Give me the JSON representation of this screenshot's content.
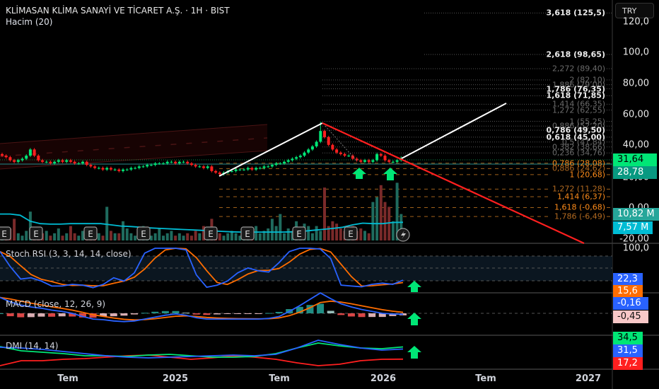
{
  "header": {
    "title": "KLİMASAN KLİMA SANAYİ VE TİCARET A.Ş. · 1H · BIST",
    "volume_indicator": "Hacim (20)"
  },
  "currency_button": "TRY",
  "price_axis": [
    "120,0",
    "100,0",
    "80,00",
    "60,00",
    "40,00",
    "20,00",
    "0,00",
    "-20,00"
  ],
  "price_badges": {
    "last": "31,64",
    "prev": "28,78",
    "volume": "10,82 M",
    "volume_ma": "7,57 M"
  },
  "fib_levels": [
    {
      "label": "3,618 (125,5)",
      "price": 125.5,
      "style": "bright"
    },
    {
      "label": "2,618 (98,65)",
      "price": 98.65,
      "style": "bright"
    },
    {
      "label": "2,272 (89,40)",
      "price": 89.4,
      "style": "dim"
    },
    {
      "label": "2 (82,10)",
      "price": 82.1,
      "style": "dim"
    },
    {
      "label": "1,886 (79,00)",
      "price": 79.0,
      "style": "dim"
    },
    {
      "label": "1,786 (76,35)",
      "price": 76.35,
      "style": "bright"
    },
    {
      "label": "1,618 (71,85)",
      "price": 71.85,
      "style": "bright"
    },
    {
      "label": "1,414 (66,35)",
      "price": 66.35,
      "style": "dim"
    },
    {
      "label": "1,272 (62,55)",
      "price": 62.55,
      "style": "dim"
    },
    {
      "label": "1 (55,25)",
      "price": 55.25,
      "style": "dim"
    },
    {
      "label": "0,886 (52,20)",
      "price": 52.2,
      "style": "dim"
    },
    {
      "label": "0,786 (49,50)",
      "price": 49.5,
      "style": "bright"
    },
    {
      "label": "0,618 (45,00)",
      "price": 45.0,
      "style": "bright"
    },
    {
      "label": "0,5 (41,84)",
      "price": 41.84,
      "style": "dim"
    },
    {
      "label": "0,382 (38,66)",
      "price": 38.66,
      "style": "dim"
    },
    {
      "label": "0,236 (34,76)",
      "price": 34.76,
      "style": "dim"
    },
    {
      "label": "0,786 (28,08)",
      "price": 28.08,
      "style": "orange"
    },
    {
      "label": "0,886 (24,62)",
      "price": 24.62,
      "style": "orange-dim"
    },
    {
      "label": "1 (20,68)",
      "price": 20.68,
      "style": "orange"
    },
    {
      "label": "1,272 (11,28)",
      "price": 11.28,
      "style": "orange-dim"
    },
    {
      "label": "1,414 (6,37)",
      "price": 6.37,
      "style": "orange"
    },
    {
      "label": "1,618 (-0,68)",
      "price": -0.68,
      "style": "orange"
    },
    {
      "label": "1,786 (-6,49)",
      "price": -6.49,
      "style": "orange-dim"
    }
  ],
  "indicators": {
    "stoch": {
      "label": "Stoch RSI (3, 3, 14, 14, close)",
      "axis_top": "100,0",
      "k_value": "22,3",
      "d_value": "15,6"
    },
    "macd": {
      "label": "MACD (close, 12, 26, 9)",
      "macd_value": "-0,16",
      "signal_value": "-0,45"
    },
    "dmi": {
      "label": "DMI (14, 14)",
      "plus_value": "34,5",
      "adx_value": "31,5",
      "minus_value": "17,2"
    }
  },
  "time_axis": [
    "Tem",
    "2025",
    "Tem",
    "2026",
    "Tem",
    "2027"
  ],
  "earnings_marker": "E",
  "colors": {
    "up": "#00e676",
    "down": "#ff1f1f",
    "vol_up": "#1f6b5e",
    "vol_down": "#7a2a2a",
    "vol_ma": "#00bcd4",
    "stoch_k": "#2962ff",
    "stoch_d": "#ff6d00",
    "dmi_plus": "#00e676",
    "dmi_minus": "#ff1f1f",
    "adx": "#2962ff"
  },
  "chart_data": {
    "type": "candlestick",
    "closes": [
      33,
      32,
      30,
      29,
      30,
      31,
      33,
      37,
      33,
      30,
      29,
      29,
      28,
      29,
      30,
      29,
      30,
      29,
      28,
      28,
      29,
      27,
      26,
      25,
      25,
      24,
      25,
      24,
      24,
      23,
      24,
      24,
      25,
      25,
      26,
      26,
      27,
      27,
      28,
      28,
      28,
      29,
      29,
      28,
      29,
      29,
      28,
      27,
      26,
      26,
      25,
      26,
      23,
      22,
      21,
      22,
      23,
      23,
      24,
      24,
      24,
      25,
      24,
      25,
      25,
      26,
      26,
      27,
      28,
      28,
      29,
      30,
      31,
      32,
      33,
      35,
      37,
      39,
      42,
      49,
      45,
      40,
      37,
      35,
      34,
      33,
      33,
      31,
      30,
      29,
      30,
      29,
      30,
      34,
      33,
      30,
      29,
      29,
      30,
      31.64
    ],
    "volumes_m": [
      4,
      3,
      5,
      9,
      3,
      2,
      4,
      12,
      3,
      2,
      3,
      4,
      2,
      3,
      5,
      2,
      3,
      6,
      3,
      2,
      4,
      3,
      2,
      5,
      3,
      2,
      14,
      4,
      3,
      3,
      8,
      5,
      3,
      2,
      4,
      6,
      3,
      2,
      3,
      5,
      2,
      3,
      4,
      2,
      3,
      2,
      3,
      2,
      4,
      3,
      6,
      4,
      9,
      5,
      3,
      2,
      3,
      4,
      3,
      2,
      4,
      3,
      2,
      6,
      3,
      4,
      5,
      9,
      6,
      11,
      3,
      5,
      4,
      8,
      4,
      7,
      6,
      3,
      6,
      4,
      22,
      6,
      8,
      7,
      5,
      4,
      3,
      6,
      4,
      5,
      4,
      3,
      16,
      18,
      23,
      16,
      14,
      8,
      24,
      11
    ],
    "volume_ma_m": [
      11,
      11,
      10.5,
      8,
      7,
      6.8,
      6.8,
      7,
      7,
      7,
      7,
      6.5,
      6,
      5.8,
      5.5,
      5.2,
      5,
      4.8,
      4.6,
      4.4,
      4.2,
      4,
      3.8,
      3.6,
      3.5,
      3.5,
      3.5,
      3.5,
      3.5,
      3.6,
      3.8,
      4.2,
      4.6,
      5,
      5.5,
      6.5,
      7.2,
      7,
      7,
      7.5,
      7.57
    ],
    "stoch_k": [
      92,
      55,
      25,
      28,
      20,
      8,
      8,
      12,
      10,
      4,
      12,
      28,
      20,
      40,
      88,
      100,
      100,
      100,
      96,
      35,
      5,
      10,
      20,
      40,
      52,
      45,
      42,
      65,
      92,
      100,
      100,
      98,
      75,
      10,
      8,
      6,
      12,
      15,
      12,
      22.3
    ],
    "macd": [
      2.5,
      1.8,
      1.3,
      1.0,
      0.8,
      0.5,
      0.3,
      0,
      -0.5,
      -0.9,
      -1.0,
      -1.2,
      -1.3,
      -1.2,
      -0.9,
      -0.6,
      -0.3,
      -0.1,
      -0.3,
      -0.7,
      -0.9,
      -0.9,
      -0.9,
      -0.9,
      -0.9,
      -0.9,
      -0.8,
      -0.5,
      0.3,
      1.2,
      2.2,
      3.2,
      2.3,
      1.5,
      1.0,
      0.6,
      0.3,
      0.0,
      -0.1,
      -0.16
    ],
    "dmi_adx": [
      34,
      33,
      31,
      28,
      25,
      22,
      20,
      19,
      20,
      21,
      22,
      23,
      22,
      24,
      33,
      44,
      38,
      33,
      30,
      31.5
    ],
    "dmi_plus": [
      35,
      29,
      27,
      25,
      22,
      22,
      21,
      23,
      24,
      22,
      20,
      20,
      21,
      25,
      33,
      40,
      36,
      33,
      32,
      34.5
    ],
    "dmi_minus": [
      8,
      15,
      15,
      17,
      18,
      20,
      22,
      23,
      20,
      17,
      19,
      22,
      20,
      17,
      12,
      8,
      10,
      15,
      17,
      17.2
    ]
  }
}
